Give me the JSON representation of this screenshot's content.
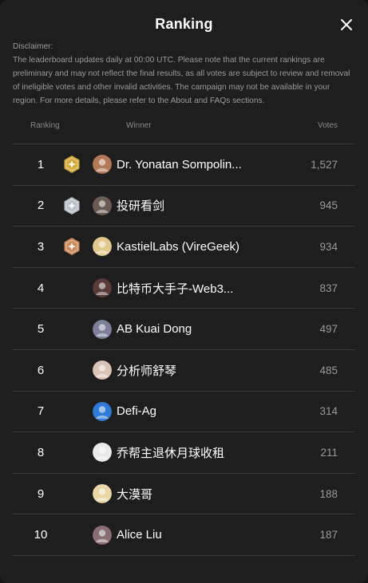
{
  "modal": {
    "title": "Ranking",
    "disclaimer": "Disclaimer:\nThe leaderboard updates daily at 00:00 UTC. Please note that the current rankings are preliminary and may not reflect the final results, as all votes are subject to review and removal of ineligible votes and other invalid activities. The campaign may not be available in your region. For more details, please refer to the About and FAQs sections.",
    "columns": {
      "ranking": "Ranking",
      "winner": "Winner",
      "votes": "Votes"
    },
    "rows": [
      {
        "rank": "1",
        "name": "Dr. Yonatan Sompolin...",
        "votes": "1,527",
        "badge": "gold-medal-icon",
        "avatar_color": "#b37a58"
      },
      {
        "rank": "2",
        "name": "投研看剑",
        "votes": "945",
        "badge": "silver-medal-icon",
        "avatar_color": "#6a5a55"
      },
      {
        "rank": "3",
        "name": "KastielLabs (VireGeek)",
        "votes": "934",
        "badge": "bronze-medal-icon",
        "avatar_color": "#e3c88f"
      },
      {
        "rank": "4",
        "name": "比特币大手子-Web3...",
        "votes": "837",
        "badge": "",
        "avatar_color": "#5a3b3b"
      },
      {
        "rank": "5",
        "name": "AB Kuai Dong",
        "votes": "497",
        "badge": "",
        "avatar_color": "#7b7f9a"
      },
      {
        "rank": "6",
        "name": "分析师舒琴",
        "votes": "485",
        "badge": "",
        "avatar_color": "#d8c5b6"
      },
      {
        "rank": "7",
        "name": "Defi-Ag",
        "votes": "314",
        "badge": "",
        "avatar_color": "#2f7bd6"
      },
      {
        "rank": "8",
        "name": "乔帮主退休月球收租",
        "votes": "211",
        "badge": "",
        "avatar_color": "#eaeaea"
      },
      {
        "rank": "9",
        "name": "大漠哥",
        "votes": "188",
        "badge": "",
        "avatar_color": "#e9d7a6"
      },
      {
        "rank": "10",
        "name": "Alice Liu",
        "votes": "187",
        "badge": "",
        "avatar_color": "#8a6f72"
      }
    ],
    "colors": {
      "background": "#1e1e1e",
      "gold": "#d4a93a",
      "silver": "#b9bfc8",
      "bronze": "#c98a5c"
    }
  }
}
